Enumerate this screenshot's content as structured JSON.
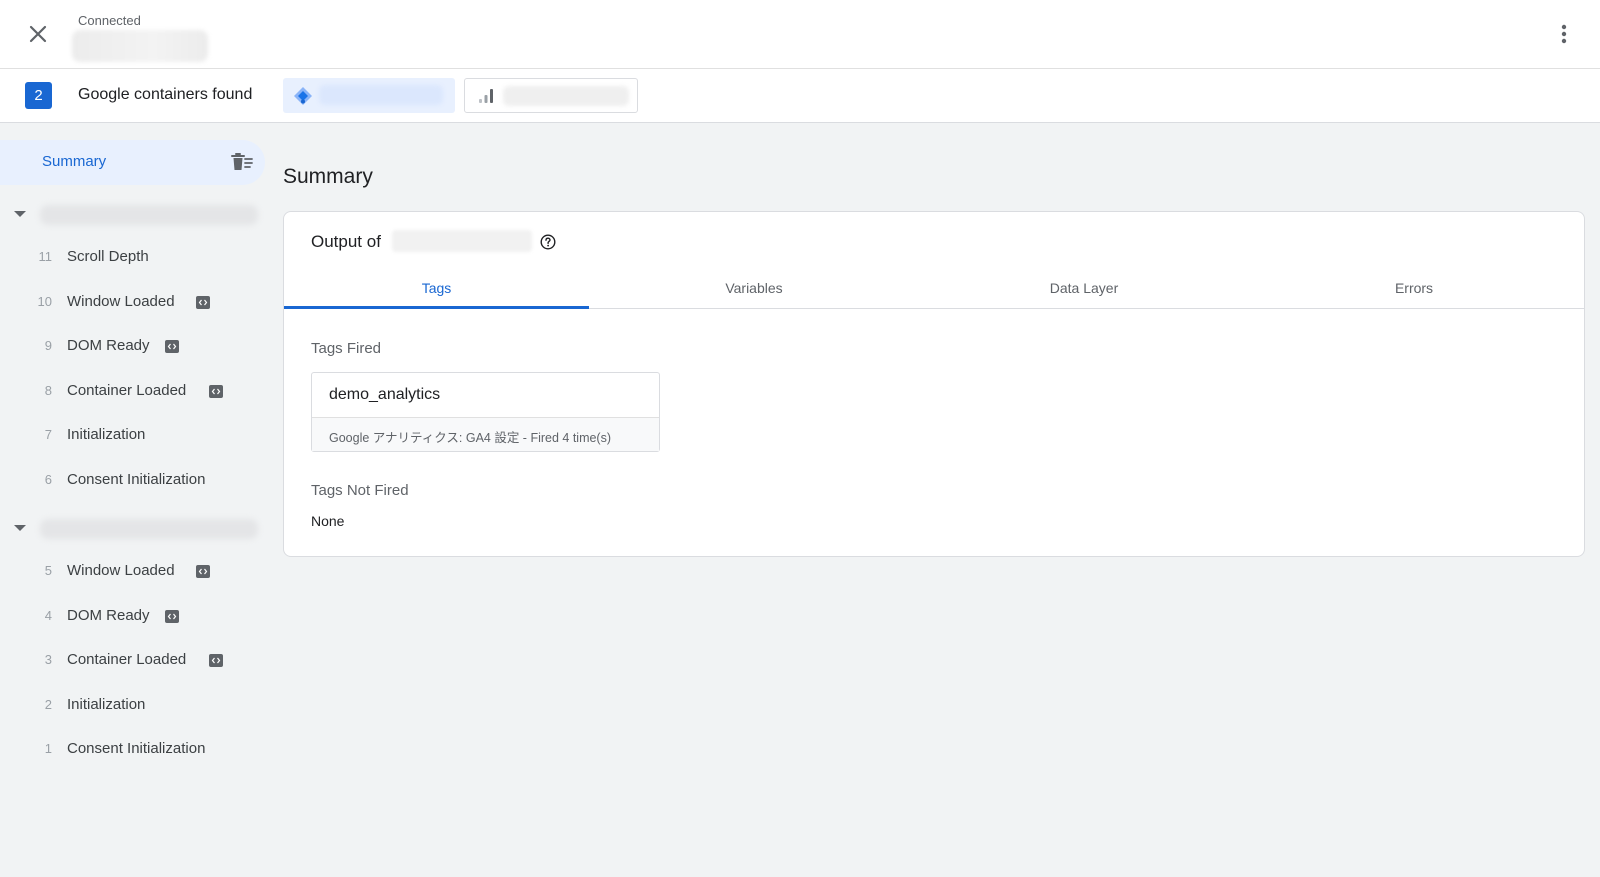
{
  "header": {
    "status": "Connected",
    "close_icon": "close-icon",
    "more_icon": "more-vert-icon"
  },
  "containers": {
    "count": "2",
    "label": "Google containers found",
    "chips": [
      {
        "icon": "gtm-diamond-icon",
        "color": "#1a73e8"
      },
      {
        "icon": "analytics-bars-icon",
        "color": "#9aa0a6"
      }
    ]
  },
  "sidebar": {
    "summary_label": "Summary",
    "summary_icon": "clear-list-icon",
    "groups": [
      {
        "events": [
          {
            "num": "11",
            "name": "Scroll Depth",
            "code": false
          },
          {
            "num": "10",
            "name": "Window Loaded",
            "code": true
          },
          {
            "num": "9",
            "name": "DOM Ready",
            "code": true
          },
          {
            "num": "8",
            "name": "Container Loaded",
            "code": true
          },
          {
            "num": "7",
            "name": "Initialization",
            "code": false
          },
          {
            "num": "6",
            "name": "Consent Initialization",
            "code": false
          }
        ]
      },
      {
        "events": [
          {
            "num": "5",
            "name": "Window Loaded",
            "code": true
          },
          {
            "num": "4",
            "name": "DOM Ready",
            "code": true
          },
          {
            "num": "3",
            "name": "Container Loaded",
            "code": true
          },
          {
            "num": "2",
            "name": "Initialization",
            "code": false
          },
          {
            "num": "1",
            "name": "Consent Initialization",
            "code": false
          }
        ]
      }
    ]
  },
  "main": {
    "title": "Summary",
    "output_label": "Output of",
    "tabs": [
      {
        "label": "Tags",
        "active": true
      },
      {
        "label": "Variables",
        "active": false
      },
      {
        "label": "Data Layer",
        "active": false
      },
      {
        "label": "Errors",
        "active": false
      }
    ],
    "tags_fired_label": "Tags Fired",
    "fired_tags": [
      {
        "name": "demo_analytics",
        "meta": "Google アナリティクス: GA4 設定 - Fired 4 time(s)"
      }
    ],
    "tags_not_fired_label": "Tags Not Fired",
    "not_fired_value": "None"
  },
  "colors": {
    "accent": "#1967d2",
    "selected_bg": "#e8f0fe",
    "page_bg": "#f1f3f4"
  }
}
